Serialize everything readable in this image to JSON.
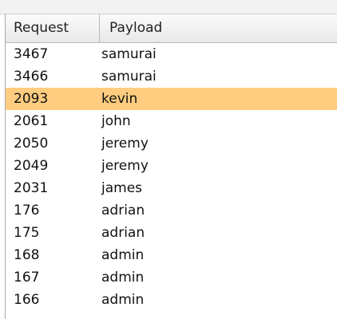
{
  "table": {
    "columns": [
      "Request",
      "Payload"
    ],
    "rows": [
      {
        "request": "3467",
        "payload": "samurai",
        "selected": false
      },
      {
        "request": "3466",
        "payload": "samurai",
        "selected": false
      },
      {
        "request": "2093",
        "payload": "kevin",
        "selected": true
      },
      {
        "request": "2061",
        "payload": "john",
        "selected": false
      },
      {
        "request": "2050",
        "payload": "jeremy",
        "selected": false
      },
      {
        "request": "2049",
        "payload": "jeremy",
        "selected": false
      },
      {
        "request": "2031",
        "payload": "james",
        "selected": false
      },
      {
        "request": "176",
        "payload": "adrian",
        "selected": false
      },
      {
        "request": "175",
        "payload": "adrian",
        "selected": false
      },
      {
        "request": "168",
        "payload": "admin",
        "selected": false
      },
      {
        "request": "167",
        "payload": "admin",
        "selected": false
      },
      {
        "request": "166",
        "payload": "admin",
        "selected": false
      }
    ]
  },
  "colors": {
    "selected_row": "#ffcc80",
    "header_border": "#b8b8b8"
  }
}
